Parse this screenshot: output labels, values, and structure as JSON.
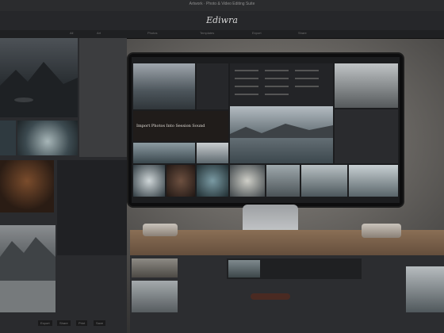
{
  "topbar": {
    "title": "Artwork · Photo & Video Editing Suite"
  },
  "app": {
    "logo": "Ediwra"
  },
  "menu": {
    "items": [
      "All",
      "Art",
      "Photos",
      "Templates",
      "Export",
      "Share"
    ]
  },
  "screen": {
    "headline": "Import Photos Into Session Sound"
  },
  "bottom": {
    "chips": [
      "Export",
      "Share",
      "Print",
      "Save"
    ]
  },
  "colors": {
    "background": "#1b1c1e",
    "panel": "#2a2b2e",
    "wood": "#8a6f55",
    "accent_teal": "#5f7f86"
  }
}
